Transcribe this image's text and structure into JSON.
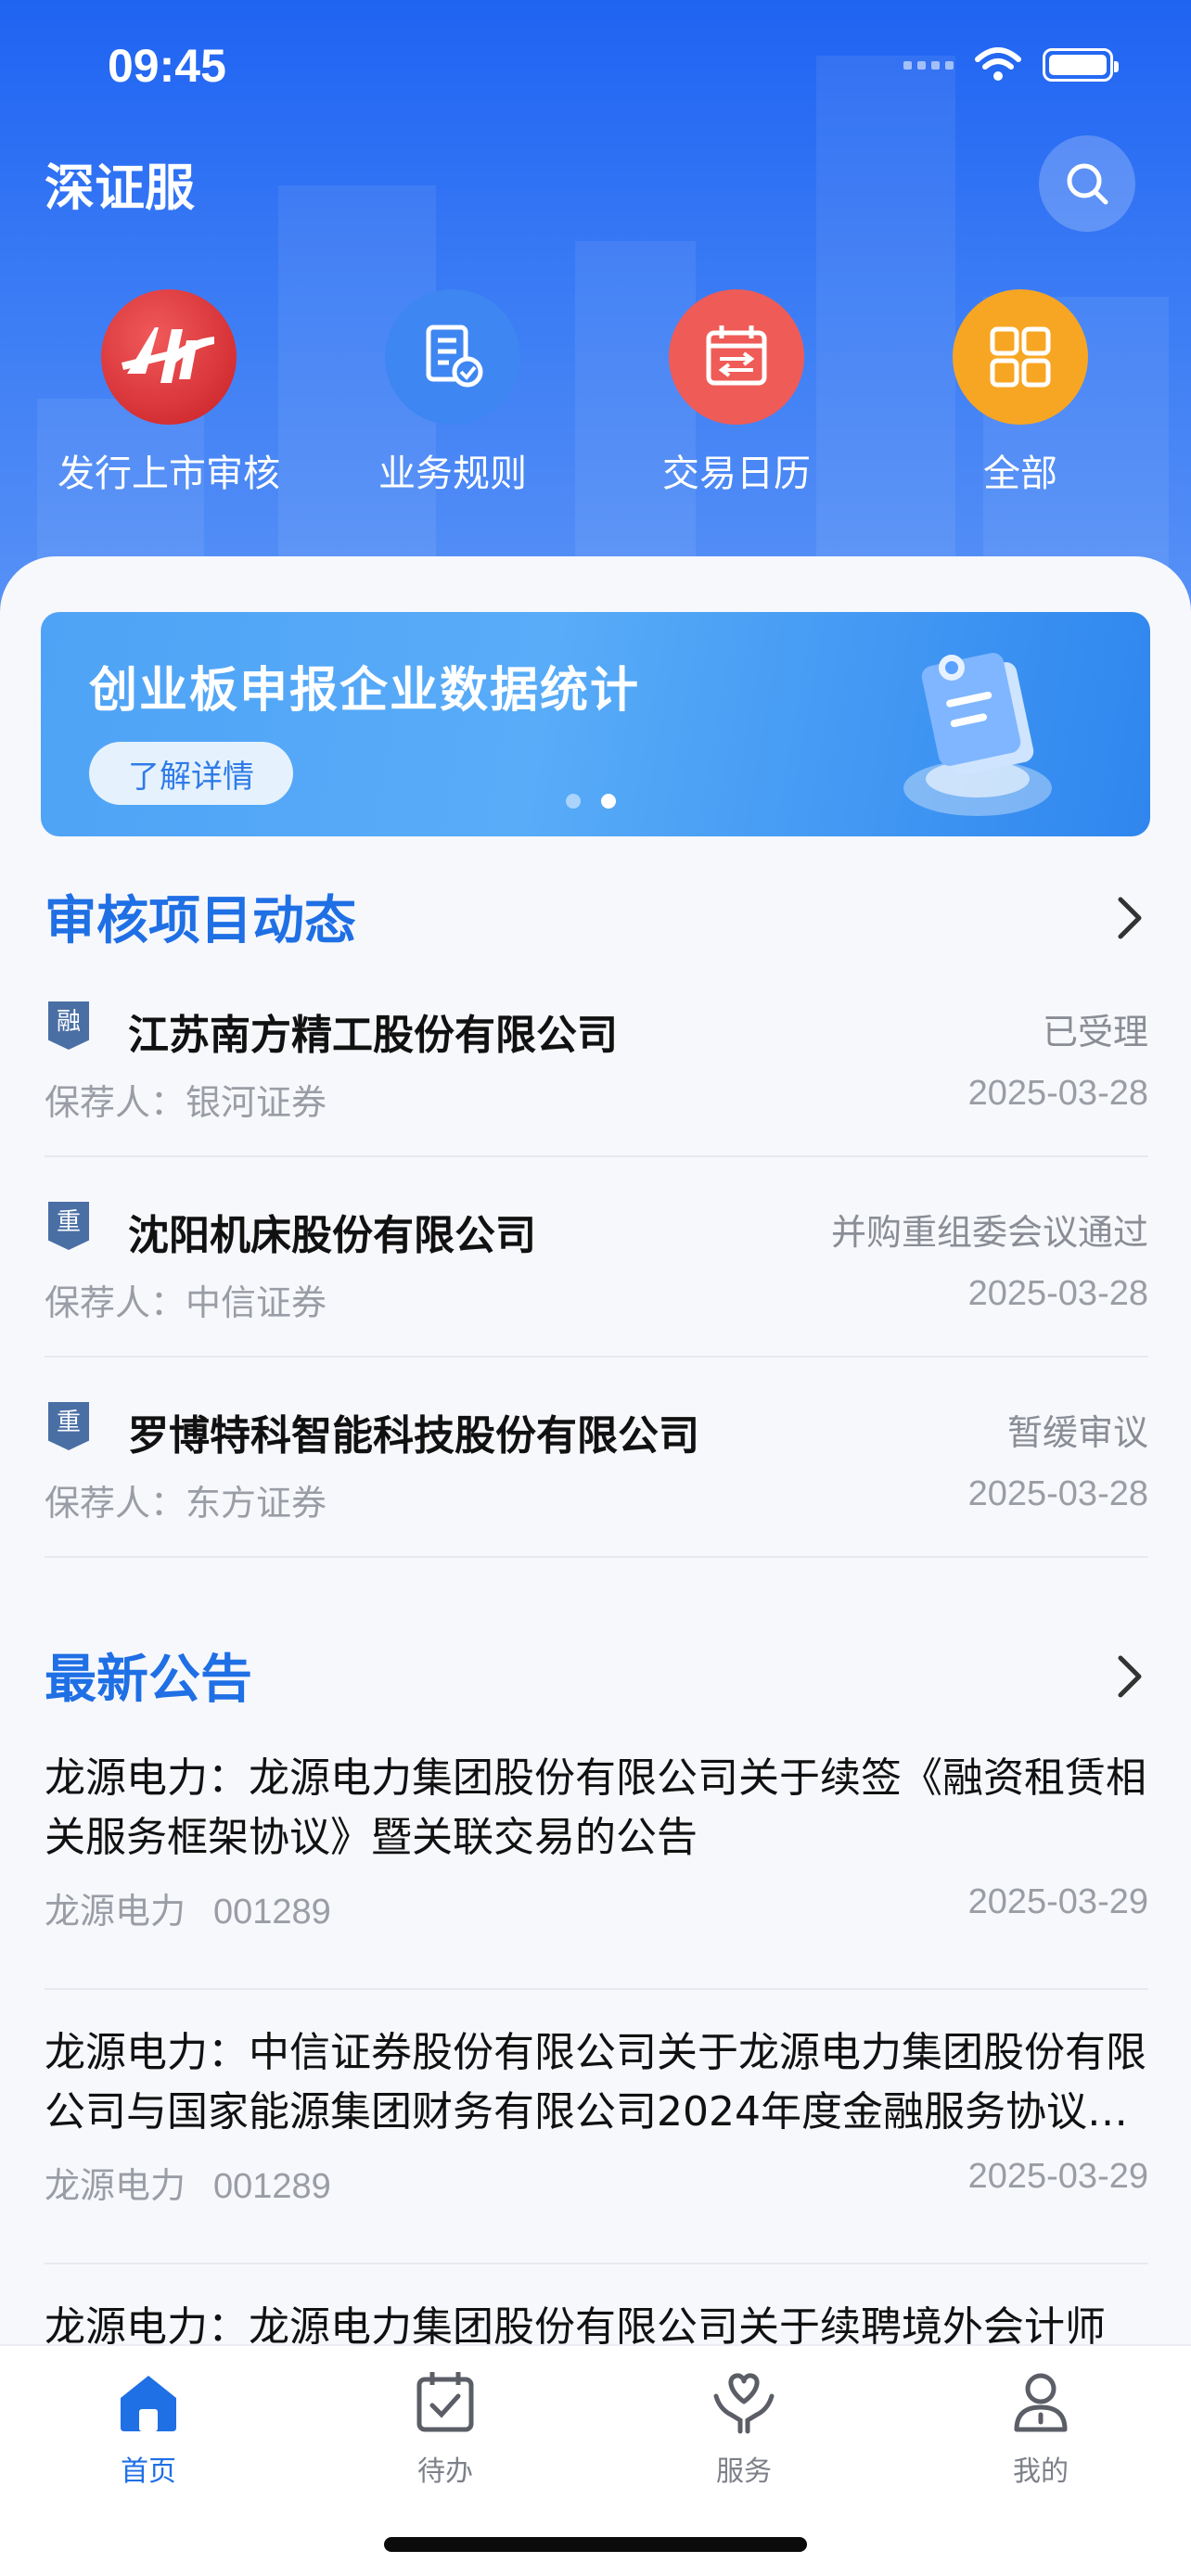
{
  "status_bar": {
    "time": "09:45"
  },
  "header": {
    "title": "深证服"
  },
  "quick_actions": [
    {
      "label": "发行上市审核",
      "icon": "listing-review-icon",
      "color": "#e23b3b"
    },
    {
      "label": "业务规则",
      "icon": "business-rules-icon",
      "color": "#3e86f2"
    },
    {
      "label": "交易日历",
      "icon": "trading-calendar-icon",
      "color": "#ef5b57"
    },
    {
      "label": "全部",
      "icon": "all-grid-icon",
      "color": "#f7a623"
    }
  ],
  "banner": {
    "title": "创业板申报企业数据统计",
    "button": "了解详情",
    "active_dot": 1
  },
  "review_section": {
    "title": "审核项目动态",
    "items": [
      {
        "badge": "融",
        "company": "江苏南方精工股份有限公司",
        "status": "已受理",
        "sponsor": "保荐人：银河证券",
        "date": "2025-03-28"
      },
      {
        "badge": "重",
        "company": "沈阳机床股份有限公司",
        "status": "并购重组委会议通过",
        "sponsor": "保荐人：中信证券",
        "date": "2025-03-28"
      },
      {
        "badge": "重",
        "company": "罗博特科智能科技股份有限公司",
        "status": "暂缓审议",
        "sponsor": "保荐人：东方证券",
        "date": "2025-03-28"
      }
    ]
  },
  "notice_section": {
    "title": "最新公告",
    "items": [
      {
        "title": "龙源电力：龙源电力集团股份有限公司关于续签《融资租赁相关服务框架协议》暨关联交易的公告",
        "issuer": "龙源电力",
        "code": "001289",
        "date": "2025-03-29"
      },
      {
        "title": "龙源电力：中信证券股份有限公司关于龙源电力集团股份有限公司与国家能源集团财务有限公司2024年度金融服务协议执行情况的核查意见",
        "issuer": "龙源电力",
        "code": "001289",
        "date": "2025-03-29"
      },
      {
        "title": "龙源电力：龙源电力集团股份有限公司关于续聘境外会计师",
        "issuer": "",
        "code": "",
        "date": ""
      }
    ]
  },
  "tabbar": {
    "items": [
      {
        "label": "首页",
        "active": true
      },
      {
        "label": "待办",
        "active": false
      },
      {
        "label": "服务",
        "active": false
      },
      {
        "label": "我的",
        "active": false
      }
    ]
  },
  "colors": {
    "primary": "#1f6fe5",
    "header_blue": "#2a6ff3",
    "badge": "#4a6fa5"
  }
}
